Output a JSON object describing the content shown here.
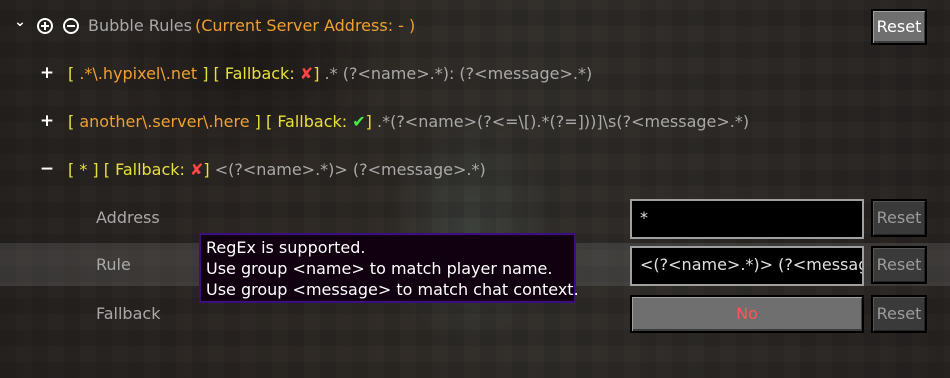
{
  "header": {
    "title": "Bubble Rules",
    "server": "(Current Server Address: - )",
    "reset_label": "Reset"
  },
  "rules": [
    {
      "sign": "+",
      "address": ".*\\.hypixel\\.net",
      "fallback_label": "Fallback: ",
      "fallback_mark": "✘",
      "pattern": ".* (?<name>.*): (?<message>.*)"
    },
    {
      "sign": "+",
      "address": "another\\.server\\.here",
      "fallback_label": "Fallback: ",
      "fallback_mark": "✔",
      "pattern": ".*(?<name>(?<=\\[).*(?=]))]\\s(?<message>.*)"
    },
    {
      "sign": "−",
      "address": "*",
      "fallback_label": "Fallback: ",
      "fallback_mark": "✘",
      "pattern": "<(?<name>.*)> (?<message>.*)"
    }
  ],
  "editor": {
    "address": {
      "label": "Address",
      "value": "*",
      "reset_label": "Reset"
    },
    "rule": {
      "label": "Rule",
      "value": "<(?<name>.*)> (?<messag",
      "reset_label": "Reset"
    },
    "fallback": {
      "label": "Fallback",
      "value": "No",
      "reset_label": "Reset"
    }
  },
  "tooltip": {
    "lines": [
      "RegEx is supported.",
      "Use group <name> to match player name.",
      "Use group <message> to match chat context."
    ]
  },
  "colors": {
    "address": "#f0a030",
    "bracket": "#e8e03a",
    "fallback_no": "#ff5555",
    "tooltip_border": "#3d0b82"
  }
}
